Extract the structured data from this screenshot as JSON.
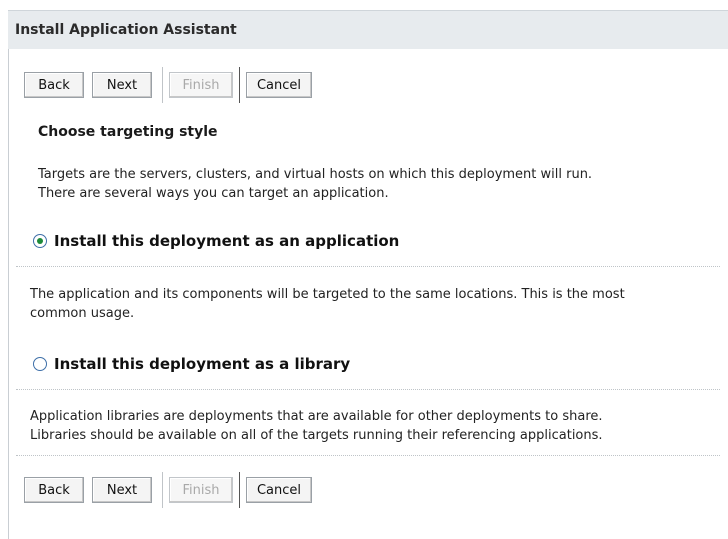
{
  "window": {
    "title": "Install Application Assistant"
  },
  "buttons": {
    "back": "Back",
    "next": "Next",
    "finish": "Finish",
    "cancel": "Cancel"
  },
  "section": {
    "heading": "Choose targeting style",
    "intro_line1": "Targets are the servers, clusters, and virtual hosts on which this deployment will run.",
    "intro_line2": "There are several ways you can target an application."
  },
  "options": [
    {
      "label": "Install this deployment as an application",
      "selected": true,
      "description_line1": "The application and its components will be targeted to the same locations. This is the most",
      "description_line2": "common usage."
    },
    {
      "label": "Install this deployment as a library",
      "selected": false,
      "description_line1": "Application libraries are deployments that are available for other deployments to share.",
      "description_line2": "Libraries should be available on all of the targets running their referencing applications."
    }
  ],
  "colors": {
    "title_bar": "#e7ebee",
    "radio_dot": "#1d8a3a",
    "radio_border": "#3e6fa8"
  }
}
